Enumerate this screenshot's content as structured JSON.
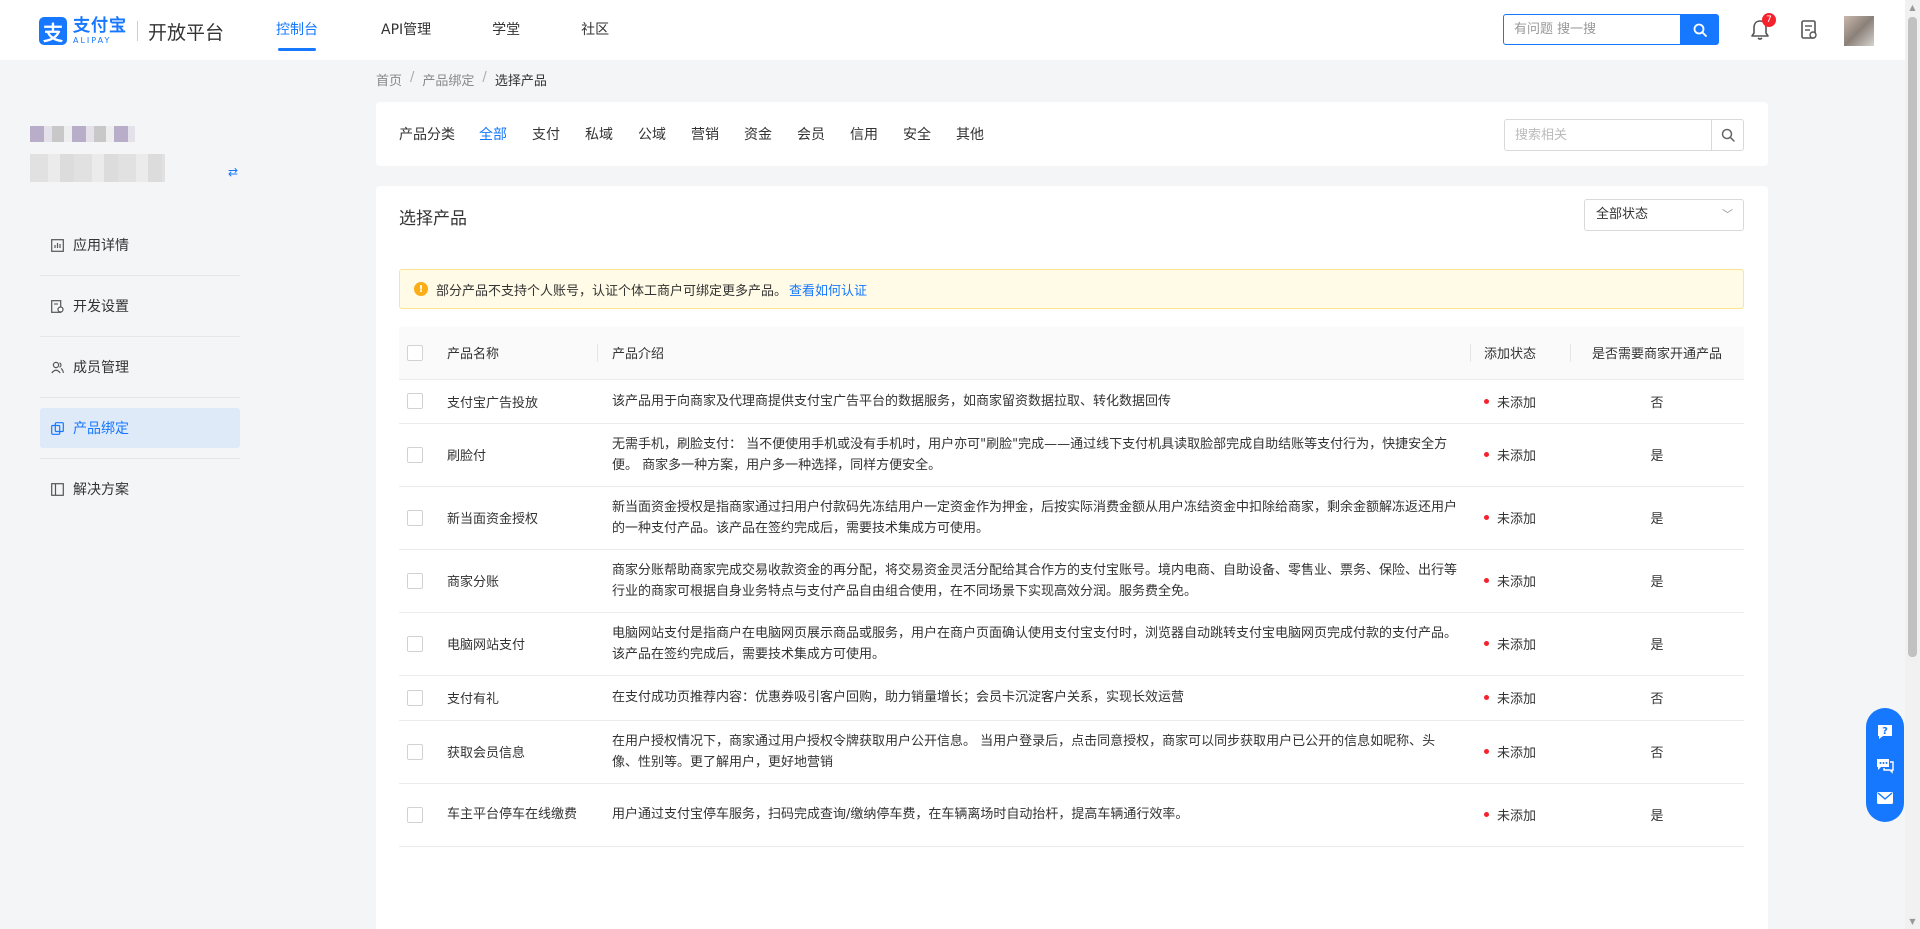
{
  "header": {
    "logo_cn": "支付宝",
    "logo_en": "ALIPAY",
    "platform": "开放平台",
    "nav": [
      {
        "label": "控制台",
        "active": true
      },
      {
        "label": "API管理",
        "active": false
      },
      {
        "label": "学堂",
        "active": false
      },
      {
        "label": "社区",
        "active": false
      }
    ],
    "search_placeholder": "有问题 搜一搜",
    "notification_count": "7"
  },
  "sidebar": {
    "items": [
      {
        "label": "应用详情",
        "icon": "chart-icon"
      },
      {
        "label": "开发设置",
        "icon": "settings-doc-icon"
      },
      {
        "label": "成员管理",
        "icon": "users-icon"
      },
      {
        "label": "产品绑定",
        "icon": "link-icon",
        "active": true
      },
      {
        "label": "解决方案",
        "icon": "book-icon"
      }
    ]
  },
  "breadcrumb": [
    "首页",
    "产品绑定",
    "选择产品"
  ],
  "filter": {
    "label": "产品分类",
    "categories": [
      {
        "label": "全部",
        "active": true
      },
      {
        "label": "支付"
      },
      {
        "label": "私域"
      },
      {
        "label": "公域"
      },
      {
        "label": "营销"
      },
      {
        "label": "资金"
      },
      {
        "label": "会员"
      },
      {
        "label": "信用"
      },
      {
        "label": "安全"
      },
      {
        "label": "其他"
      }
    ],
    "search_placeholder": "搜索相关"
  },
  "main": {
    "title": "选择产品",
    "status_select": "全部状态",
    "notice_text": "部分产品不支持个人账号，认证个体工商户可绑定更多产品。",
    "notice_link": "查看如何认证"
  },
  "table": {
    "headers": [
      "产品名称",
      "产品介绍",
      "添加状态",
      "是否需要商家开通产品"
    ],
    "rows": [
      {
        "name": "支付宝广告投放",
        "desc": "该产品用于向商家及代理商提供支付宝广告平台的数据服务，如商家留资数据拉取、转化数据回传",
        "status": "未添加",
        "need": "否"
      },
      {
        "name": "刷脸付",
        "desc": "无需手机，刷脸支付： 当不便使用手机或没有手机时，用户亦可\"刷脸\"完成——通过线下支付机具读取脸部完成自助结账等支付行为，快捷安全方便。 商家多一种方案，用户多一种选择，同样方便安全。",
        "status": "未添加",
        "need": "是"
      },
      {
        "name": "新当面资金授权",
        "desc": "新当面资金授权是指商家通过扫用户付款码先冻结用户一定资金作为押金，后按实际消费金额从用户冻结资金中扣除给商家，剩余金额解冻返还用户的一种支付产品。该产品在签约完成后，需要技术集成方可使用。",
        "status": "未添加",
        "need": "是"
      },
      {
        "name": "商家分账",
        "desc": "商家分账帮助商家完成交易收款资金的再分配，将交易资金灵活分配给其合作方的支付宝账号。境内电商、自助设备、零售业、票务、保险、出行等行业的商家可根据自身业务特点与支付产品自由组合使用，在不同场景下实现高效分润。服务费全免。",
        "status": "未添加",
        "need": "是"
      },
      {
        "name": "电脑网站支付",
        "desc": "电脑网站支付是指商户在电脑网页展示商品或服务，用户在商户页面确认使用支付宝支付时，浏览器自动跳转支付宝电脑网页完成付款的支付产品。该产品在签约完成后，需要技术集成方可使用。",
        "status": "未添加",
        "need": "是"
      },
      {
        "name": "支付有礼",
        "desc": "在支付成功页推荐内容：优惠券吸引客户回购，助力销量增长；会员卡沉淀客户关系，实现长效运营",
        "status": "未添加",
        "need": "否"
      },
      {
        "name": "获取会员信息",
        "desc": "在用户授权情况下，商家通过用户授权令牌获取用户公开信息。 当用户登录后，点击同意授权，商家可以同步获取用户已公开的信息如昵称、头像、性别等。更了解用户，更好地营销",
        "status": "未添加",
        "need": "否"
      },
      {
        "name": "车主平台停车在线缴费",
        "desc": "用户通过支付宝停车服务，扫码完成查询/缴纳停车费，在车辆离场时自动抬杆，提高车辆通行效率。",
        "status": "未添加",
        "need": "是"
      }
    ]
  },
  "colors": {
    "accent": "#1677ff",
    "status_dot": "#f5222d",
    "notice_bg": "#fffbe6"
  },
  "float_tools": [
    "help-icon",
    "chat-icon",
    "feedback-icon"
  ]
}
